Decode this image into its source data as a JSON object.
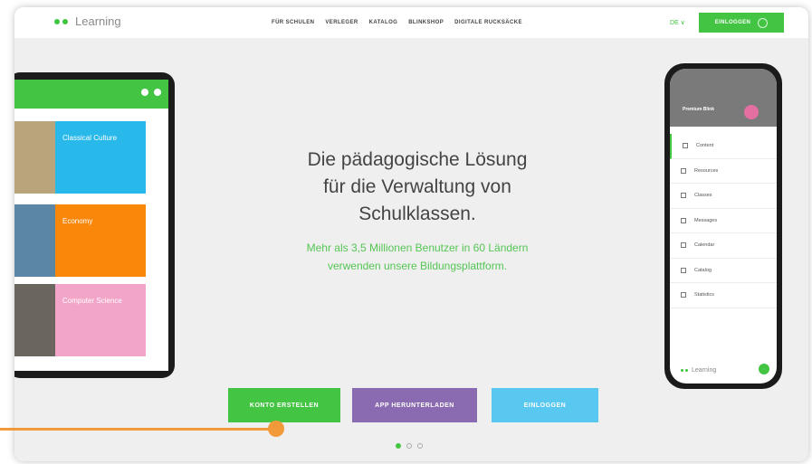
{
  "header": {
    "logo_text": "Learning",
    "nav": [
      "FÜR SCHULEN",
      "VERLEGER",
      "KATALOG",
      "BLINKSHOP",
      "DIGITALE RUCKSÄCKE"
    ],
    "language": "DE ∨",
    "login_label": "EINLOGGEN"
  },
  "hero": {
    "title_lines": [
      "Die pädagogische Lösung",
      "für die Verwaltung von",
      "Schulklassen."
    ],
    "subtitle_lines": [
      "Mehr als 3,5 Millionen Benutzer in 60 Ländern",
      "verwenden unsere Bildungsplattform."
    ]
  },
  "cta": {
    "create_account": "KONTO ERSTELLEN",
    "download_app": "APP HERUNTERLADEN",
    "login": "EINLOGGEN"
  },
  "carousel": {
    "active_index": 0,
    "count": 3
  },
  "tablet": {
    "courses": [
      {
        "label": "Classical Culture",
        "color": "#28b8ea"
      },
      {
        "label": "Economy",
        "color": "#f9870a"
      },
      {
        "label": "Computer Science",
        "color": "#f3a5c9"
      }
    ]
  },
  "phone": {
    "header_name": "Premium Blink",
    "menu_items": [
      "Content",
      "Resources",
      "Classes",
      "Messages",
      "Calendar",
      "Catalog",
      "Statistics"
    ],
    "logo_text": "Learning"
  },
  "colors": {
    "brand_green": "#43c543",
    "purple": "#8a6ab0",
    "blue": "#58c8f1",
    "orange_annotation": "#f29a3a"
  },
  "icons": {
    "user": "user-icon",
    "logo_dots": "logo-dots-icon",
    "whatsapp": "whatsapp-icon"
  }
}
